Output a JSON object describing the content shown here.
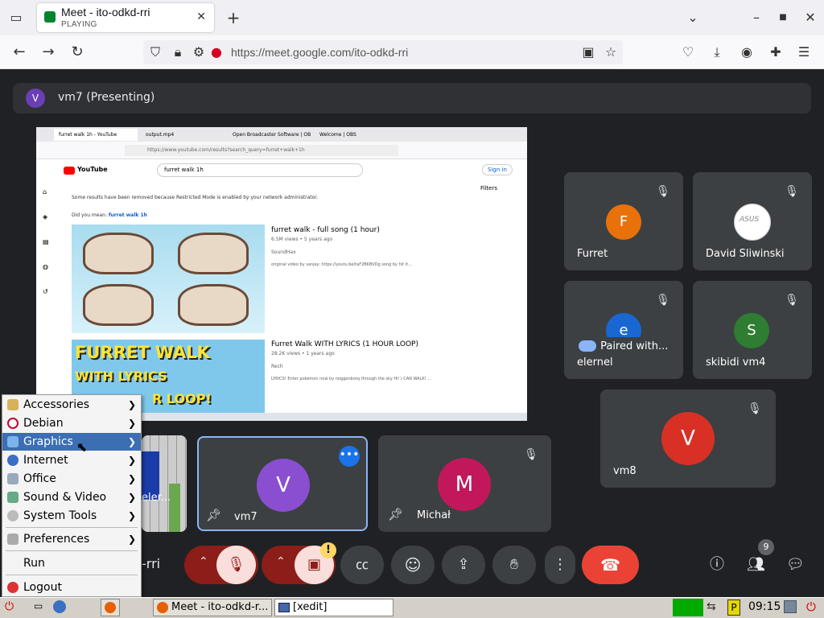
{
  "browser": {
    "tab_title": "Meet - ito-odkd-rri",
    "tab_status": "PLAYING",
    "url_host": "https://meet.google.com/",
    "url_path": "ito-odkd-rri"
  },
  "meet": {
    "presenting_initial": "V",
    "presenting_label": "vm7 (Presenting)",
    "shared_tab": {
      "tabs": [
        "furret walk 1h - YouTube",
        "output.mp4",
        "Open Broadcaster Software | OB",
        "Welcome | OBS"
      ],
      "url": "https://www.youtube.com/results?search_query=furret+walk+1h",
      "search_value": "furret walk 1h",
      "signin_label": "Sign in",
      "filters_label": "Filters",
      "restricted_notice": "Some results have been removed because Restricted Mode is enabled by your network administrator.",
      "did_you_mean": "Did you mean:",
      "did_you_mean_query": "furret walk 1h",
      "results": [
        {
          "title": "furret walk - full song (1 hour)",
          "meta": "6.5M views • 5 years ago",
          "channel": "SoundHax",
          "desc": "original video by sanjay: https://youtu.be/taF2BKBVDg song by hit it..."
        },
        {
          "title": "Furret Walk WITH LYRICS (1 HOUR LOOP)",
          "meta": "28.2K views • 1 years ago",
          "channel": "Rech",
          "desc": "LYRICS! Enter pokemon now by noggenborq through the sky Hi! I CAN WALK! ..."
        }
      ],
      "thumb2_lines": [
        "FURRET WALK",
        "WITH LYRICS",
        "R LOOP!"
      ]
    },
    "participants": [
      {
        "name": "Furret",
        "initial": "F",
        "color": "#e8710a"
      },
      {
        "name": "David Sliwinski",
        "initial": "",
        "color": "#ffffff"
      },
      {
        "name": "elernel",
        "initial": "e",
        "color": "#1967d2",
        "badge": "Paired with..."
      },
      {
        "name": "skibidi vm4",
        "initial": "S",
        "color": "#2e7d32"
      },
      {
        "name": "vm8",
        "initial": "V",
        "color": "#d93025"
      },
      {
        "name": "vm7",
        "initial": "V",
        "color": "#8a4fd0"
      },
      {
        "name": "Michał",
        "initial": "M",
        "color": "#c2185b"
      }
    ],
    "partial_tile_name": "eler...",
    "meeting_code_partial": "-rri",
    "people_count": "9",
    "warning_badge": "!"
  },
  "start_menu": {
    "items": [
      {
        "label": "Accessories",
        "icon": "accessories-icon",
        "submenu": true
      },
      {
        "label": "Debian",
        "icon": "debian-icon",
        "submenu": true
      },
      {
        "label": "Graphics",
        "icon": "graphics-icon",
        "submenu": true
      },
      {
        "label": "Internet",
        "icon": "internet-icon",
        "submenu": true
      },
      {
        "label": "Office",
        "icon": "office-icon",
        "submenu": true
      },
      {
        "label": "Sound & Video",
        "icon": "sound-video-icon",
        "submenu": true
      },
      {
        "label": "System Tools",
        "icon": "system-tools-icon",
        "submenu": true
      },
      {
        "label": "Preferences",
        "icon": "preferences-icon",
        "submenu": true
      },
      {
        "label": "Run",
        "icon": "",
        "submenu": false
      },
      {
        "label": "Logout",
        "icon": "logout-icon",
        "submenu": false
      }
    ],
    "selected": "Graphics"
  },
  "taskbar": {
    "window1": "Meet - ito-odkd-r...",
    "window2": "[xedit]",
    "clock": "09:15"
  },
  "colors": {
    "accent": "#8ab4f8",
    "end_call": "#ea4335",
    "mic_off": "#8c1d18",
    "selected_menu": "#3c6eb4"
  }
}
